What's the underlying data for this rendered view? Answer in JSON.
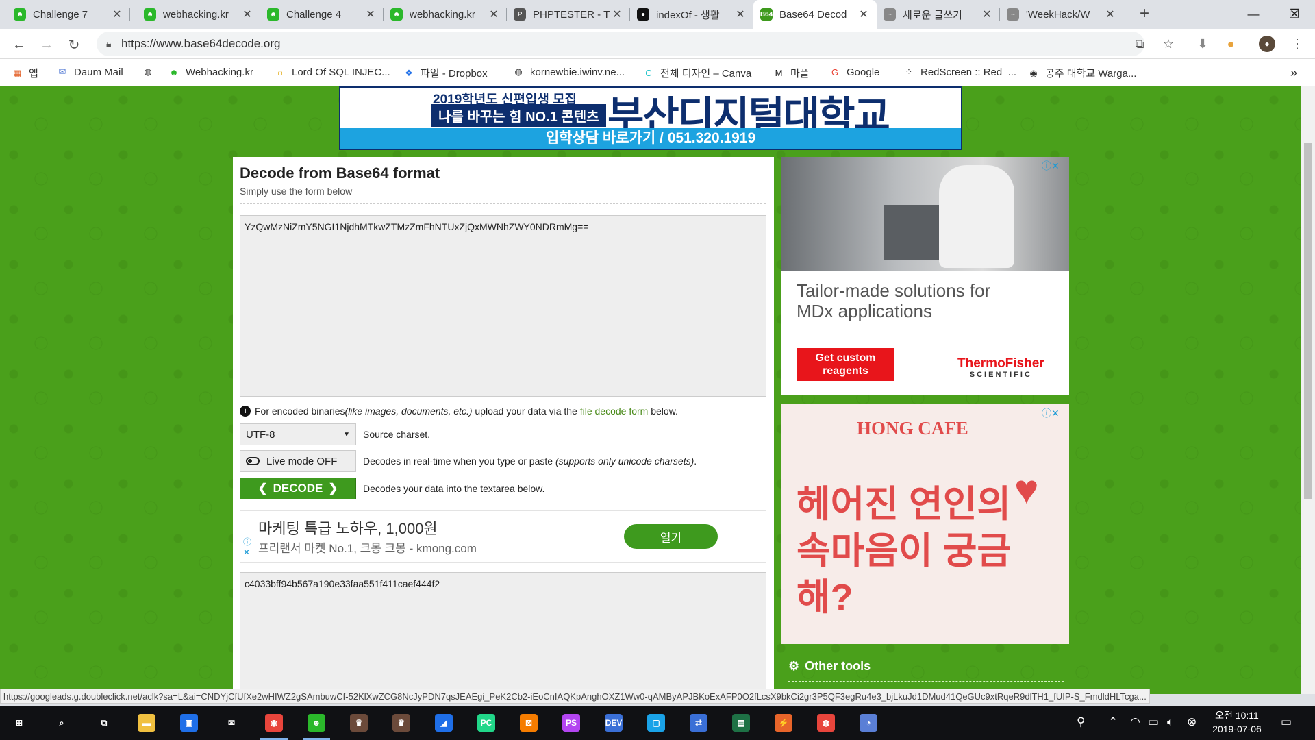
{
  "tabs": [
    {
      "title": "Challenge 7",
      "color": "#2bb82b",
      "glyph": "☻"
    },
    {
      "title": "webhacking.kr",
      "color": "#2bb82b",
      "glyph": "☻"
    },
    {
      "title": "Challenge 4",
      "color": "#2bb82b",
      "glyph": "☻"
    },
    {
      "title": "webhacking.kr",
      "color": "#2bb82b",
      "glyph": "☻"
    },
    {
      "title": "PHPTESTER - T",
      "color": "#555",
      "glyph": "P"
    },
    {
      "title": "indexOf - 생활",
      "color": "#111",
      "glyph": "●"
    },
    {
      "title": "Base64 Decod",
      "color": "#3e9a1e",
      "glyph": "B64",
      "active": true
    },
    {
      "title": "새로운 글쓰기",
      "color": "#888",
      "glyph": "~"
    },
    {
      "title": "'WeekHack/W",
      "color": "#888",
      "glyph": "~"
    }
  ],
  "close_glyph": "✕",
  "newtab_glyph": "+",
  "window": {
    "minimize": "—",
    "maximize": "❐",
    "close": "✕"
  },
  "url": "https://www.base64decode.org",
  "bookmarks": [
    {
      "label": "앱",
      "icon": "apps-icon",
      "glyph": "▦",
      "color": "#e3622a"
    },
    {
      "label": "Daum Mail",
      "icon": "mail-icon",
      "glyph": "✉",
      "color": "#5a7fd6"
    },
    {
      "label": "",
      "icon": "globe-icon",
      "glyph": "◍",
      "color": "#333"
    },
    {
      "label": "Webhacking.kr",
      "icon": "webhacking-icon",
      "glyph": "☻",
      "color": "#2bb82b"
    },
    {
      "label": "Lord Of SQL INJEC...",
      "icon": "lord-icon",
      "glyph": "∩",
      "color": "#e0a300"
    },
    {
      "label": "파일 - Dropbox",
      "icon": "dropbox-icon",
      "glyph": "❖",
      "color": "#1f6fe8"
    },
    {
      "label": "kornewbie.iwinv.ne...",
      "icon": "globe-icon",
      "glyph": "◍",
      "color": "#333"
    },
    {
      "label": "전체 디자인 – Canva",
      "icon": "canva-icon",
      "glyph": "C",
      "color": "#1cc3c9"
    },
    {
      "label": "마플",
      "icon": "marpple-icon",
      "glyph": "M",
      "color": "#111"
    },
    {
      "label": "Google",
      "icon": "google-icon",
      "glyph": "G",
      "color": "#ea4335"
    },
    {
      "label": "RedScreen :: Red_...",
      "icon": "redscreen-icon",
      "glyph": "⁘",
      "color": "#333"
    },
    {
      "label": "공주 대학교 Warga...",
      "icon": "wargame-icon",
      "glyph": "◉",
      "color": "#333"
    }
  ],
  "bookmarks_more": "»",
  "banner": {
    "line1": "2019학년도 신편입생 모집",
    "line2": "나를 바꾸는 힘 NO.1 콘텐츠",
    "brand": "부산디지털대학교",
    "contact": "입학상담 바로가기 / 051.320.1919"
  },
  "main": {
    "title": "Decode from Base64 format",
    "subtitle": "Simply use the form below",
    "input_value": "YzQwMzNiZmY5NGI1NjdhMTkwZTMzZmFhNTUxZjQxMWNhZWY0NDRmMg==",
    "info_prefix": "For encoded binaries ",
    "info_italic": "(like images, documents, etc.)",
    "info_mid": " upload your data via the ",
    "info_link": "file decode form",
    "info_suffix": " below.",
    "charset_value": "UTF-8",
    "charset_desc": "Source charset.",
    "livemode_label": "Live mode OFF",
    "livemode_desc": "Decodes in real-time when you type or paste ",
    "livemode_desc_italic": "(supports only unicode charsets)",
    "livemode_desc_end": ".",
    "decode_label": "DECODE",
    "decode_desc": "Decodes your data into the textarea below.",
    "output_value": "c4033bff94b567a190e33faa551f411caef444f2"
  },
  "inline_ad": {
    "headline": "마케팅 특급 노하우, 1,000원",
    "sub": "프리랜서 마켓 No.1, 크몽 크몽 - kmong.com",
    "button": "열기"
  },
  "ad1": {
    "headline": "Tailor-made solutions for MDx applications",
    "button": "Get custom reagents",
    "brand": "ThermoFisher",
    "brand_sub": "SCIENTIFIC"
  },
  "ad2": {
    "brand": "HONG CAFE",
    "message": "헤어진 연인의 속마음이 궁금해?"
  },
  "other_tools": "Other tools",
  "status_url": "https://googleads.g.doubleclick.net/aclk?sa=L&ai=CNDYjCfUfXe2wHIWZ2gSAmbuwCf-52KlXwZCG8NcJyPDN7qsJEAEgi_PeK2Cb2-iEoCnIAQKpAnghOXZ1Ww0-qAMByAPJBKoExAFP0O2fLcsX9bkCi2gr3P5QF3egRu4e3_bjLkuJd1DMud41QeGUc9xtRqeR9dlTH1_fUIP-S_FmdldHLTcga...",
  "taskbar": {
    "apps": [
      {
        "name": "start",
        "glyph": "⊞",
        "color": "transparent"
      },
      {
        "name": "search",
        "glyph": "⌕",
        "color": "transparent"
      },
      {
        "name": "task-view",
        "glyph": "⧉",
        "color": "transparent"
      },
      {
        "name": "file-explorer",
        "glyph": "▬",
        "color": "#f0c040"
      },
      {
        "name": "store",
        "glyph": "▣",
        "color": "#1f6fe8"
      },
      {
        "name": "mail",
        "glyph": "✉",
        "color": "transparent"
      },
      {
        "name": "chrome",
        "glyph": "◉",
        "color": "#e8453c",
        "open": true
      },
      {
        "name": "webhacking-app",
        "glyph": "☻",
        "color": "#2bb82b",
        "open": true
      },
      {
        "name": "app-avatar-1",
        "glyph": "♛",
        "color": "#6b4a3a"
      },
      {
        "name": "app-avatar-2",
        "glyph": "♛",
        "color": "#6b4a3a"
      },
      {
        "name": "edge-app",
        "glyph": "◢",
        "color": "#1f6fe8"
      },
      {
        "name": "pycharm",
        "glyph": "PC",
        "color": "#21d789"
      },
      {
        "name": "xampp",
        "glyph": "⊠",
        "color": "#f57c00"
      },
      {
        "name": "phpstorm",
        "glyph": "PS",
        "color": "#b345f1"
      },
      {
        "name": "devcpp",
        "glyph": "DEV",
        "color": "#3a6fd6"
      },
      {
        "name": "app-blue",
        "glyph": "▢",
        "color": "#1aa3e8"
      },
      {
        "name": "network-app",
        "glyph": "⇄",
        "color": "#3a6fd6"
      },
      {
        "name": "excel-app",
        "glyph": "▤",
        "color": "#1e7145"
      },
      {
        "name": "burp",
        "glyph": "⚡",
        "color": "#e8652a"
      },
      {
        "name": "app-swirl",
        "glyph": "◍",
        "color": "#e8453c"
      },
      {
        "name": "app-notify",
        "glyph": "◔",
        "color": "#5a7fd6"
      }
    ],
    "time": "오전 10:11",
    "date": "2019-07-06"
  }
}
